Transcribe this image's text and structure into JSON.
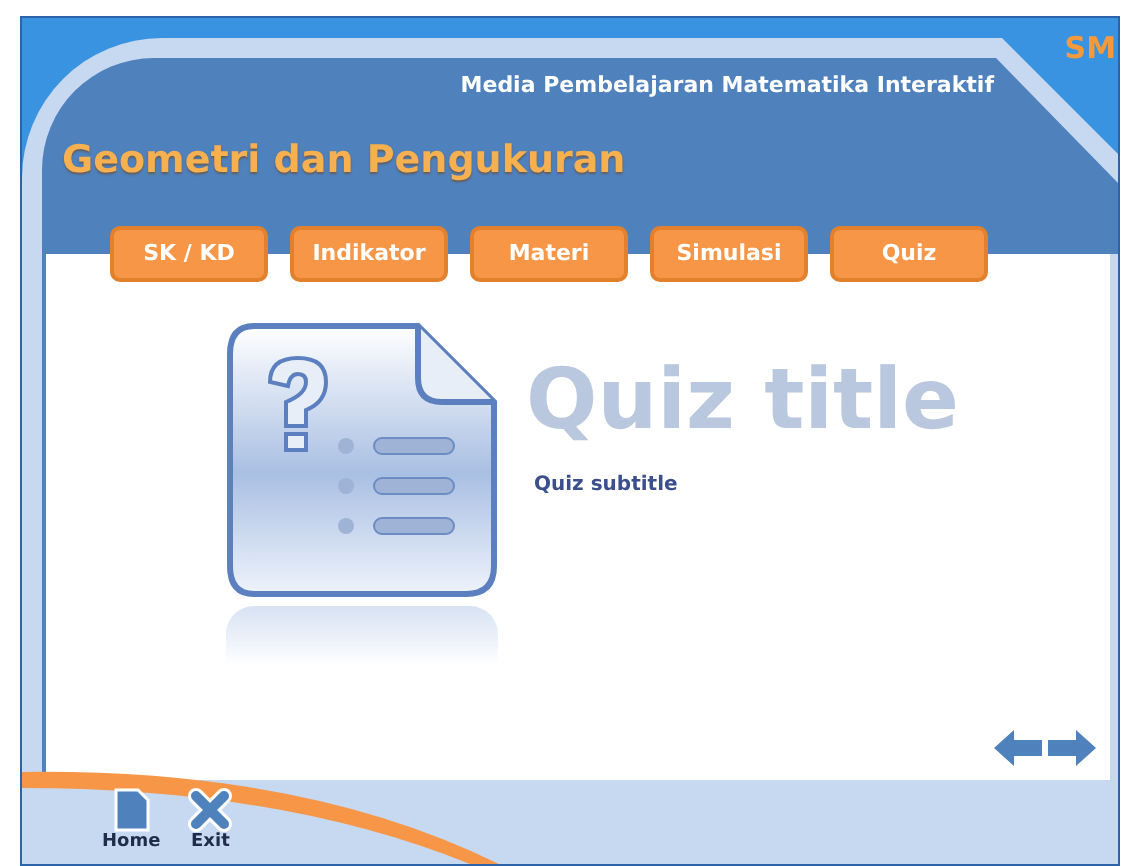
{
  "header": {
    "caption": "Media Pembelajaran Matematika Interaktif",
    "corner_text": "SM",
    "title": "Geometri dan Pengukuran"
  },
  "tabs": [
    {
      "label": "SK / KD"
    },
    {
      "label": "Indikator"
    },
    {
      "label": "Materi"
    },
    {
      "label": "Simulasi"
    },
    {
      "label": "Quiz"
    }
  ],
  "content": {
    "title": "Quiz title",
    "subtitle": "Quiz subtitle"
  },
  "footer": {
    "buttons": [
      {
        "kind": "home",
        "label": "Home"
      },
      {
        "kind": "exit",
        "label": "Exit"
      }
    ]
  }
}
